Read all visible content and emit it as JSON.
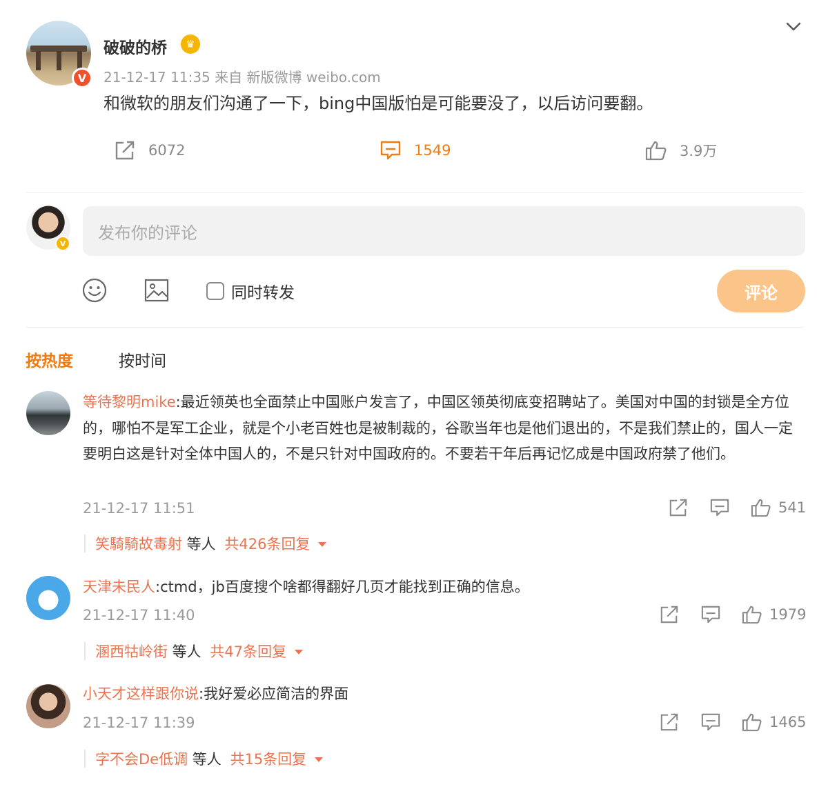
{
  "post": {
    "author": "破破的桥",
    "meta": "21-12-17 11:35  来自 新版微博 weibo.com",
    "text": "和微软的朋友们沟通了一下，bing中国版怕是可能要没了，以后访问要翻。",
    "reposts": "6072",
    "comments": "1549",
    "likes": "3.9万"
  },
  "compose": {
    "placeholder": "发布你的评论",
    "forward_label": "同时转发",
    "submit_label": "评论"
  },
  "sort_tabs": [
    "按热度",
    "按时间"
  ],
  "comments": [
    {
      "user": "等待黎明mike",
      "text": ":最近领英也全面禁止中国账户发言了，中国区领英彻底变招聘站了。美国对中国的封锁是全方位的，哪怕不是军工企业，就是个小老百姓也是被制裁的，谷歌当年也是他们退出的，不是我们禁止的，国人一定要明白这是针对全体中国人的，不是只针对中国政府的。不要若干年后再记忆成是中国政府禁了他们。",
      "time": "21-12-17 11:51",
      "likes": "541",
      "reply_user": "笑騎騎故毒射",
      "reply_mid": " 等人 ",
      "reply_total": "共426条回复"
    },
    {
      "user": "天津未民人",
      "text": ":ctmd，jb百度搜个啥都得翻好几页才能找到正确的信息。",
      "time": "21-12-17 11:40",
      "likes": "1979",
      "reply_user": "溷西牯岭街",
      "reply_mid": " 等人 ",
      "reply_total": "共47条回复"
    },
    {
      "user": "小天才这样跟你说",
      "text": ":我好爱必应简洁的界面",
      "time": "21-12-17 11:39",
      "likes": "1465",
      "reply_user": "字不会De低调",
      "reply_mid": " 等人 ",
      "reply_total": "共15条回复"
    }
  ]
}
